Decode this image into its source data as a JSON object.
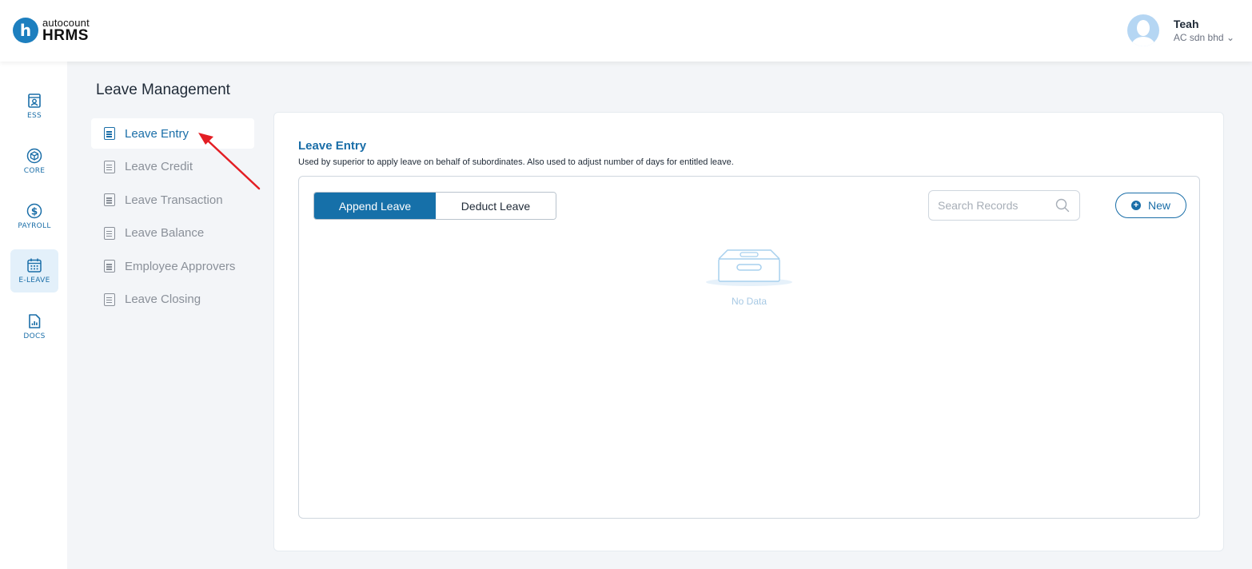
{
  "header": {
    "logo_brand": "autocount",
    "logo_product": "HRMS",
    "user": {
      "name": "Teah",
      "company": "AC sdn bhd",
      "company_chevron": "⌄"
    }
  },
  "rail": {
    "items": [
      {
        "label": "ESS",
        "icon": "id-card-icon",
        "active": false
      },
      {
        "label": "CORE",
        "icon": "cube-icon",
        "active": false
      },
      {
        "label": "PAYROLL",
        "icon": "dollar-icon",
        "active": false
      },
      {
        "label": "E-LEAVE",
        "icon": "calendar-icon",
        "active": true
      },
      {
        "label": "DOCS",
        "icon": "document-chart-icon",
        "active": false
      }
    ]
  },
  "page": {
    "title": "Leave Management"
  },
  "submenu": {
    "items": [
      {
        "label": "Leave Entry",
        "active": true
      },
      {
        "label": "Leave Credit",
        "active": false
      },
      {
        "label": "Leave Transaction",
        "active": false
      },
      {
        "label": "Leave Balance",
        "active": false
      },
      {
        "label": "Employee Approvers",
        "active": false
      },
      {
        "label": "Leave Closing",
        "active": false
      }
    ]
  },
  "main": {
    "title": "Leave Entry",
    "description": "Used by superior to apply leave on behalf of subordinates. Also used to adjust number of days for entitled leave.",
    "tabs": [
      {
        "label": "Append Leave",
        "active": true
      },
      {
        "label": "Deduct Leave",
        "active": false
      }
    ],
    "search": {
      "placeholder": "Search Records",
      "value": ""
    },
    "new_button": "New",
    "empty_text": "No Data"
  },
  "colors": {
    "accent": "#1a6ea8",
    "active_tab": "#1670a9",
    "background": "#f3f5f8",
    "annotation": "#e31e24"
  }
}
